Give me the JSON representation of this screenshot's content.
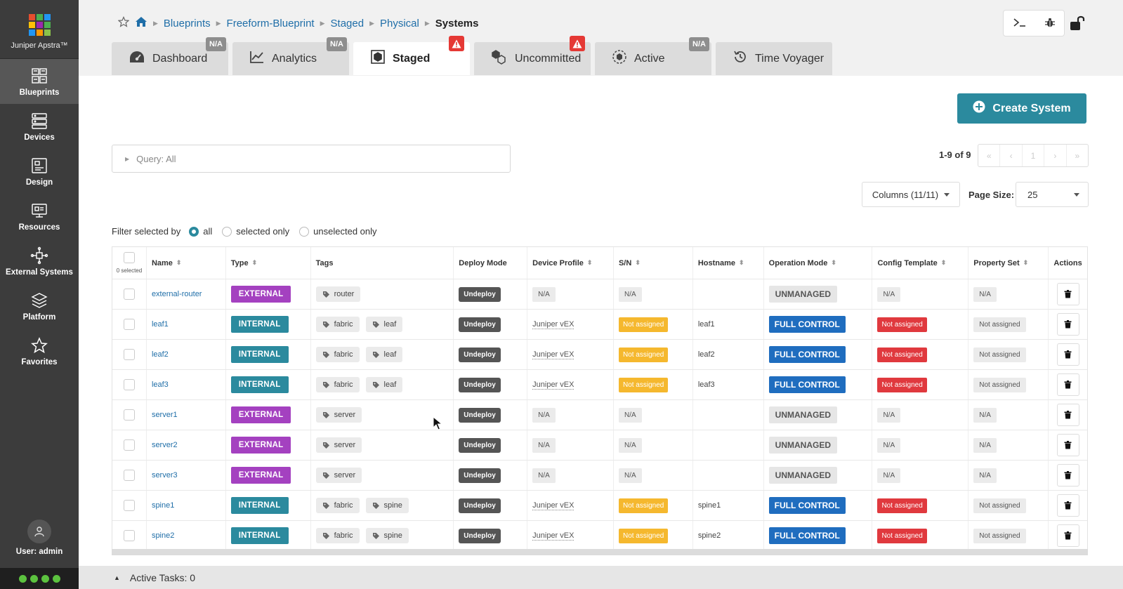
{
  "brand": {
    "name": "Juniper Apstra™",
    "logo_colors": [
      "#e54d2e",
      "#4caf50",
      "#2196f3",
      "#ffc107",
      "#9c27b0",
      "#4caf50",
      "#2196f3",
      "#ff9800",
      "#8bc34a"
    ]
  },
  "sidebar": {
    "items": [
      {
        "label": "Blueprints",
        "icon": "blueprints-icon",
        "active": true
      },
      {
        "label": "Devices",
        "icon": "devices-icon"
      },
      {
        "label": "Design",
        "icon": "design-icon"
      },
      {
        "label": "Resources",
        "icon": "resources-icon"
      },
      {
        "label": "External Systems",
        "icon": "external-systems-icon"
      },
      {
        "label": "Platform",
        "icon": "platform-icon"
      },
      {
        "label": "Favorites",
        "icon": "star-icon"
      }
    ],
    "user": "User: admin"
  },
  "breadcrumb": {
    "items": [
      "Blueprints",
      "Freeform-Blueprint",
      "Staged",
      "Physical"
    ],
    "current": "Systems"
  },
  "tabs": [
    {
      "label": "Dashboard",
      "badge": "N/A"
    },
    {
      "label": "Analytics",
      "badge": "N/A"
    },
    {
      "label": "Staged",
      "badge": "warning"
    },
    {
      "label": "Uncommitted",
      "badge": "warning"
    },
    {
      "label": "Active",
      "badge": "N/A"
    },
    {
      "label": "Time Voyager",
      "badge": ""
    }
  ],
  "actions": {
    "create_system": "Create System"
  },
  "query": {
    "label": "Query: All"
  },
  "pagination": {
    "count": "1-9 of 9",
    "current_page": "1",
    "first": "«",
    "prev": "‹",
    "next": "›",
    "last": "»"
  },
  "columns_button": "Columns (11/11)",
  "page_size": {
    "label": "Page Size:",
    "value": "25"
  },
  "filter": {
    "label": "Filter selected by",
    "options": [
      "all",
      "selected only",
      "unselected only"
    ],
    "selected": "all"
  },
  "table": {
    "selected_count": "0 selected",
    "headers": [
      "Name",
      "Type",
      "Tags",
      "Deploy Mode",
      "Device Profile",
      "S/N",
      "Hostname",
      "Operation Mode",
      "Config Template",
      "Property Set",
      "Actions"
    ],
    "rows": [
      {
        "name": "external-router",
        "type": "EXTERNAL",
        "tags": [
          "router"
        ],
        "deploy": "Undeploy",
        "profile": "N/A",
        "sn": "N/A",
        "hostname": "",
        "op_mode": "UNMANAGED",
        "config_template": "N/A",
        "property_set": "N/A"
      },
      {
        "name": "leaf1",
        "type": "INTERNAL",
        "tags": [
          "fabric",
          "leaf"
        ],
        "deploy": "Undeploy",
        "profile": "Juniper vEX",
        "sn": "Not assigned",
        "hostname": "leaf1",
        "op_mode": "FULL CONTROL",
        "config_template": "Not assigned",
        "property_set": "Not assigned"
      },
      {
        "name": "leaf2",
        "type": "INTERNAL",
        "tags": [
          "fabric",
          "leaf"
        ],
        "deploy": "Undeploy",
        "profile": "Juniper vEX",
        "sn": "Not assigned",
        "hostname": "leaf2",
        "op_mode": "FULL CONTROL",
        "config_template": "Not assigned",
        "property_set": "Not assigned"
      },
      {
        "name": "leaf3",
        "type": "INTERNAL",
        "tags": [
          "fabric",
          "leaf"
        ],
        "deploy": "Undeploy",
        "profile": "Juniper vEX",
        "sn": "Not assigned",
        "hostname": "leaf3",
        "op_mode": "FULL CONTROL",
        "config_template": "Not assigned",
        "property_set": "Not assigned"
      },
      {
        "name": "server1",
        "type": "EXTERNAL",
        "tags": [
          "server"
        ],
        "deploy": "Undeploy",
        "profile": "N/A",
        "sn": "N/A",
        "hostname": "",
        "op_mode": "UNMANAGED",
        "config_template": "N/A",
        "property_set": "N/A"
      },
      {
        "name": "server2",
        "type": "EXTERNAL",
        "tags": [
          "server"
        ],
        "deploy": "Undeploy",
        "profile": "N/A",
        "sn": "N/A",
        "hostname": "",
        "op_mode": "UNMANAGED",
        "config_template": "N/A",
        "property_set": "N/A"
      },
      {
        "name": "server3",
        "type": "EXTERNAL",
        "tags": [
          "server"
        ],
        "deploy": "Undeploy",
        "profile": "N/A",
        "sn": "N/A",
        "hostname": "",
        "op_mode": "UNMANAGED",
        "config_template": "N/A",
        "property_set": "N/A"
      },
      {
        "name": "spine1",
        "type": "INTERNAL",
        "tags": [
          "fabric",
          "spine"
        ],
        "deploy": "Undeploy",
        "profile": "Juniper vEX",
        "sn": "Not assigned",
        "hostname": "spine1",
        "op_mode": "FULL CONTROL",
        "config_template": "Not assigned",
        "property_set": "Not assigned"
      },
      {
        "name": "spine2",
        "type": "INTERNAL",
        "tags": [
          "fabric",
          "spine"
        ],
        "deploy": "Undeploy",
        "profile": "Juniper vEX",
        "sn": "Not assigned",
        "hostname": "spine2",
        "op_mode": "FULL CONTROL",
        "config_template": "Not assigned",
        "property_set": "Not assigned"
      }
    ]
  },
  "colors": {
    "external": "#a441c0",
    "internal": "#2b8a9e",
    "accent": "#2b8a9e",
    "link": "#1f6ea8"
  },
  "footer": {
    "active_tasks": "Active Tasks: 0"
  }
}
